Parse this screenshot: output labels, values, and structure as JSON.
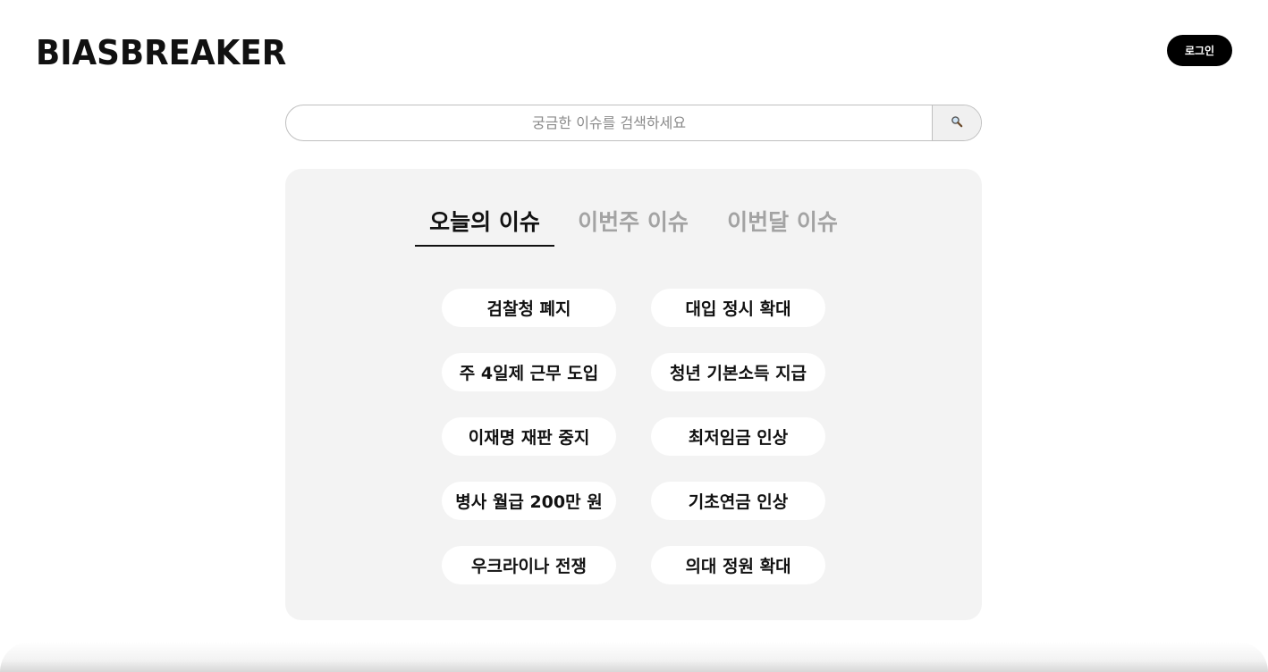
{
  "header": {
    "logo": "BIASBREAKER",
    "login_label": "로그인"
  },
  "search": {
    "placeholder": "궁금한 이슈를 검색하세요",
    "button_icon": "search-icon"
  },
  "tabs": [
    {
      "label": "오늘의 이슈",
      "active": true
    },
    {
      "label": "이번주 이슈",
      "active": false
    },
    {
      "label": "이번달 이슈",
      "active": false
    }
  ],
  "issues": [
    {
      "label": "검찰청 폐지"
    },
    {
      "label": "대입 정시 확대"
    },
    {
      "label": "주 4일제 근무 도입"
    },
    {
      "label": "청년 기본소득 지급"
    },
    {
      "label": "이재명 재판 중지"
    },
    {
      "label": "최저임금 인상"
    },
    {
      "label": "병사 월급 200만 원"
    },
    {
      "label": "기초연금 인상"
    },
    {
      "label": "우크라이나 전쟁"
    },
    {
      "label": "의대 정원 확대"
    }
  ],
  "colors": {
    "panel_bg": "#f3f3f3",
    "active_tab": "#111111",
    "inactive_tab": "#a3a3a3",
    "login_bg": "#000000"
  }
}
